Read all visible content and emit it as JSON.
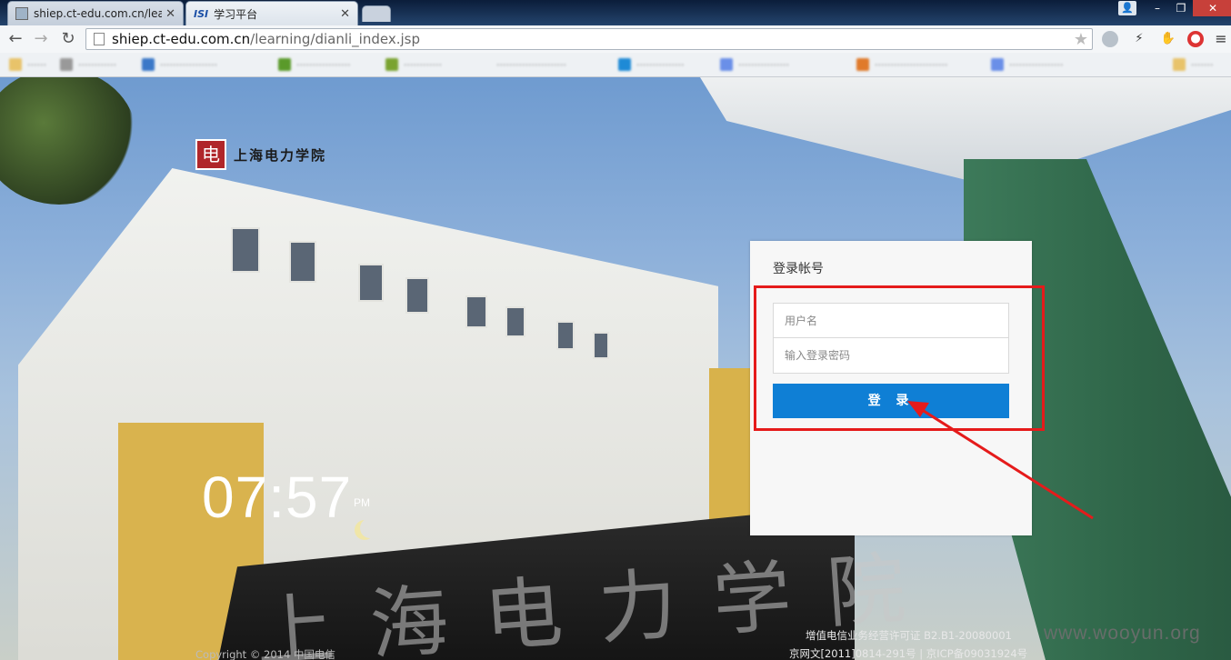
{
  "browser": {
    "tabs": [
      {
        "title": "shiep.ct-edu.com.cn/learn",
        "active": false
      },
      {
        "title": "学习平台",
        "favicon_text": "ISI",
        "active": true
      }
    ],
    "url": {
      "host": "shiep.ct-edu.com.cn",
      "path": "/learning/dianli_index.jsp"
    },
    "icons": {
      "back": "arrow-left-icon",
      "forward": "arrow-right-icon",
      "reload": "reload-icon",
      "page": "page-icon",
      "bookmark": "star-icon",
      "menu": "hamburger-menu-icon"
    }
  },
  "page": {
    "logo": {
      "seal": "电",
      "name": "上海电力学院"
    },
    "clock": {
      "time": "07:57",
      "ampm": "PM"
    },
    "login": {
      "title": "登录帐号",
      "username_placeholder": "用户名",
      "password_placeholder": "输入登录密码",
      "submit_label": "登 录",
      "accent": "#0f7fd5"
    },
    "wall_inscription": "上海电力学院",
    "footer": {
      "copyright": "Copyright © 2014 中国电信",
      "license": "增值电信业务经营许可证 B2.B1-20080001",
      "icp": "京网文[2011]0814-291号 | 京ICP备09031924号"
    },
    "watermark": "www.wooyun.org",
    "annotation_color": "#e51b1b"
  }
}
